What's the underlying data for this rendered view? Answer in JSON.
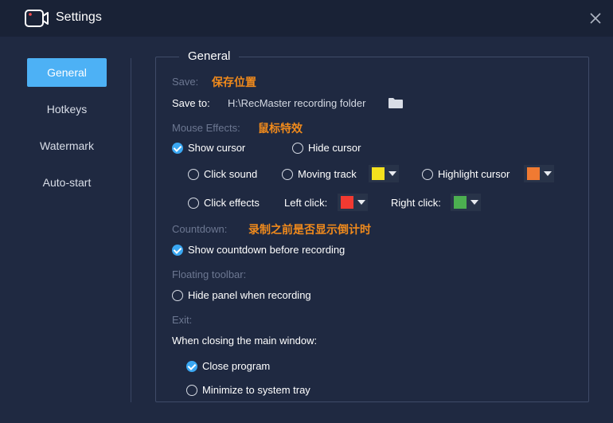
{
  "window": {
    "title": "Settings"
  },
  "sidebar": {
    "items": [
      {
        "label": "General"
      },
      {
        "label": "Hotkeys"
      },
      {
        "label": "Watermark"
      },
      {
        "label": "Auto-start"
      }
    ]
  },
  "panel": {
    "legend": "General",
    "save": {
      "section": "Save:",
      "annotation": "保存位置",
      "save_to_label": "Save to:",
      "path": "H:\\RecMaster recording folder"
    },
    "mouse": {
      "section": "Mouse Effects:",
      "annotation": "鼠标特效",
      "show_cursor": "Show cursor",
      "hide_cursor": "Hide cursor",
      "click_sound": "Click sound",
      "moving_track": "Moving track",
      "highlight_cursor": "Highlight cursor",
      "click_effects": "Click effects",
      "left_click": "Left click:",
      "right_click": "Right click:",
      "colors": {
        "moving_track": "#f5e11e",
        "highlight_cursor": "#f07a32",
        "left_click": "#f23a31",
        "right_click": "#4caf50"
      }
    },
    "countdown": {
      "section": "Countdown:",
      "annotation": "录制之前是否显示倒计时",
      "show_countdown": "Show countdown before recording"
    },
    "floating_toolbar": {
      "section": "Floating toolbar:",
      "hide_panel": "Hide panel when recording"
    },
    "exit": {
      "section": "Exit:",
      "closing_label": "When closing the main window:",
      "close_program": "Close program",
      "minimize_tray": "Minimize to system tray"
    }
  },
  "colors": {
    "accent": "#4db1f5",
    "annotation": "#f08a1c",
    "background": "#1f2941"
  }
}
